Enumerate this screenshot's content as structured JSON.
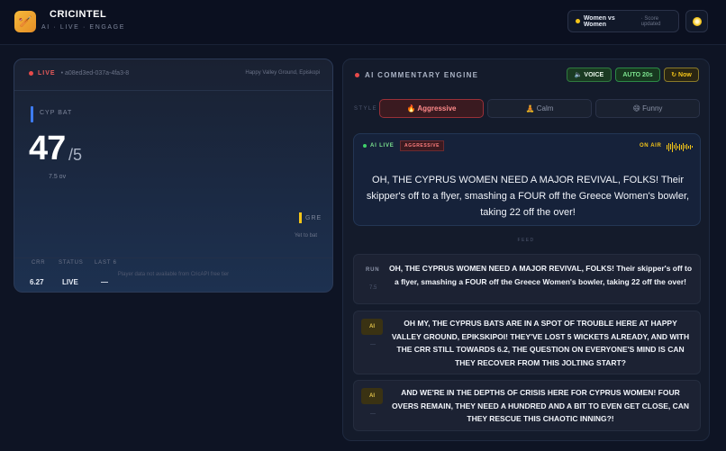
{
  "header": {
    "logo_glyph": "🏏",
    "brand": "CRICINTEL",
    "tagline": "AI · LIVE · ENGAGE",
    "match_pill": {
      "name": "Women vs Women",
      "status": "· Score updated"
    },
    "theme_icon": "sun-icon"
  },
  "score_card": {
    "live_label": "LIVE",
    "match_id": "a08ed3ed-037a-4fa3-8",
    "venue": "Happy Valley Ground, Episkopi",
    "batting_team": "CYP",
    "batting_label": "BAT",
    "runs": "47",
    "wickets": "/5",
    "overs": "7.5 ov",
    "opponent": "GRE",
    "opponent_sub": "Yet to bat",
    "stats": [
      {
        "label": "CRR",
        "value": "6.27"
      },
      {
        "label": "STATUS",
        "value": "LIVE"
      },
      {
        "label": "LAST 6",
        "value": "—"
      }
    ],
    "player_note": "Player data not available from CricAPI free tier"
  },
  "commentary": {
    "title": "AI COMMENTARY ENGINE",
    "controls": {
      "voice": "🔈 VOICE",
      "auto": "AUTO 20s",
      "now": "↻ Now"
    },
    "style_label": "STYLE",
    "styles": [
      {
        "label": "🔥 Aggressive",
        "active": true
      },
      {
        "label": "🧘 Calm",
        "active": false
      },
      {
        "label": "😄 Funny",
        "active": false
      }
    ],
    "on_air": {
      "ai_live": "AI LIVE",
      "mode_badge": "AGGRESSIVE",
      "on_air_label": "ON AIR",
      "text": "OH, THE CYPRUS WOMEN NEED A MAJOR REVIVAL, FOLKS! Their skipper's off to a flyer, smashing a FOUR off the Greece Women's bowler, taking 22 off the over!"
    },
    "feed_label": "FEED",
    "feed": [
      {
        "tag": "RUN",
        "sub": "7.5",
        "text": "OH, THE CYPRUS WOMEN NEED A MAJOR REVIVAL, FOLKS! Their skipper's off to a flyer, smashing a FOUR off the Greece Women's bowler, taking 22 off the over!"
      },
      {
        "tag": "AI",
        "sub": "—",
        "text": "OH MY, THE CYPRUS BATS ARE IN A SPOT OF TROUBLE HERE AT HAPPY VALLEY GROUND, EPIKSKIPOI! THEY'VE LOST 5 WICKETS ALREADY, AND WITH THE CRR STILL TOWARDS 6.2, THE QUESTION ON EVERYONE'S MIND IS CAN THEY RECOVER FROM THIS JOLTING START?"
      },
      {
        "tag": "AI",
        "sub": "—",
        "text": "AND WE'RE IN THE DEPTHS OF CRISIS HERE FOR CYPRUS WOMEN! FOUR OVERS REMAIN, THEY NEED A HUNDRED AND A BIT TO EVEN GET CLOSE, CAN THEY RESCUE THIS CHAOTIC INNING?!"
      }
    ]
  },
  "colors": {
    "accent_yellow": "#f5c518",
    "live_red": "#e84a4a",
    "ai_green": "#3fd16a",
    "background": "#0e1424"
  }
}
